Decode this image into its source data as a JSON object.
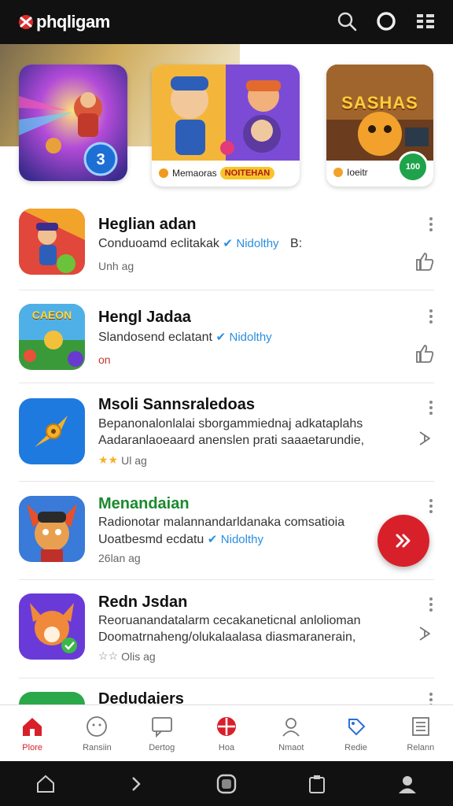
{
  "app": {
    "name": "phqligam"
  },
  "featured": [
    {
      "label": "",
      "pill": ""
    },
    {
      "label": "Memaoras",
      "pill": "NOITEHAN"
    },
    {
      "label": "Ioeitr",
      "banner": "SASHAS",
      "badge": "100"
    }
  ],
  "apps": [
    {
      "title": "Heglian adan",
      "desc1": "Conduoamd eclitakak",
      "verified": "Nidolthy",
      "extra": "B:",
      "meta": "Unh ag"
    },
    {
      "title": "Hengl Jadaa",
      "desc1": "Slandosend eclatant",
      "verified": "Nidolthy",
      "meta": "on",
      "banner": "CAEON"
    },
    {
      "title": "Msoli Sannsraledoas",
      "desc1": "Bepanonalonlalai sborgammiednaj adkataplahs",
      "desc2": "Aadaranlaoeaard anenslen prati saaaetarundie,",
      "meta": "Ul ag"
    },
    {
      "title": "Menandaian",
      "desc1": "Radionotar malannandarldanaka comsatioia",
      "desc2": "Uoatbesmd ecdatu",
      "verified": "Nidolthy",
      "meta": "26lan ag"
    },
    {
      "title": "Redn Jsdan",
      "desc1": "Reoruanandatalarm cecakaneticnal anlolioman",
      "desc2": "Doomatrnaheng/olukalaalasa diasmaranerain,",
      "meta": "Olis ag"
    },
    {
      "title": "Dedudaiers"
    }
  ],
  "nav": [
    {
      "label": "Plore"
    },
    {
      "label": "Ransiin"
    },
    {
      "label": "Dertog"
    },
    {
      "label": "Hoa"
    },
    {
      "label": "Nmaot"
    },
    {
      "label": "Redie"
    },
    {
      "label": "Relann"
    }
  ],
  "colors": {
    "accent": "#d8202a",
    "topbar": "#111111",
    "verified": "#2a8ee0",
    "green": "#1a8a2e"
  },
  "icons": {
    "search": "search-icon",
    "circle": "circle-icon",
    "menu": "menu-icon",
    "fab": "double-chevron-right-icon"
  }
}
